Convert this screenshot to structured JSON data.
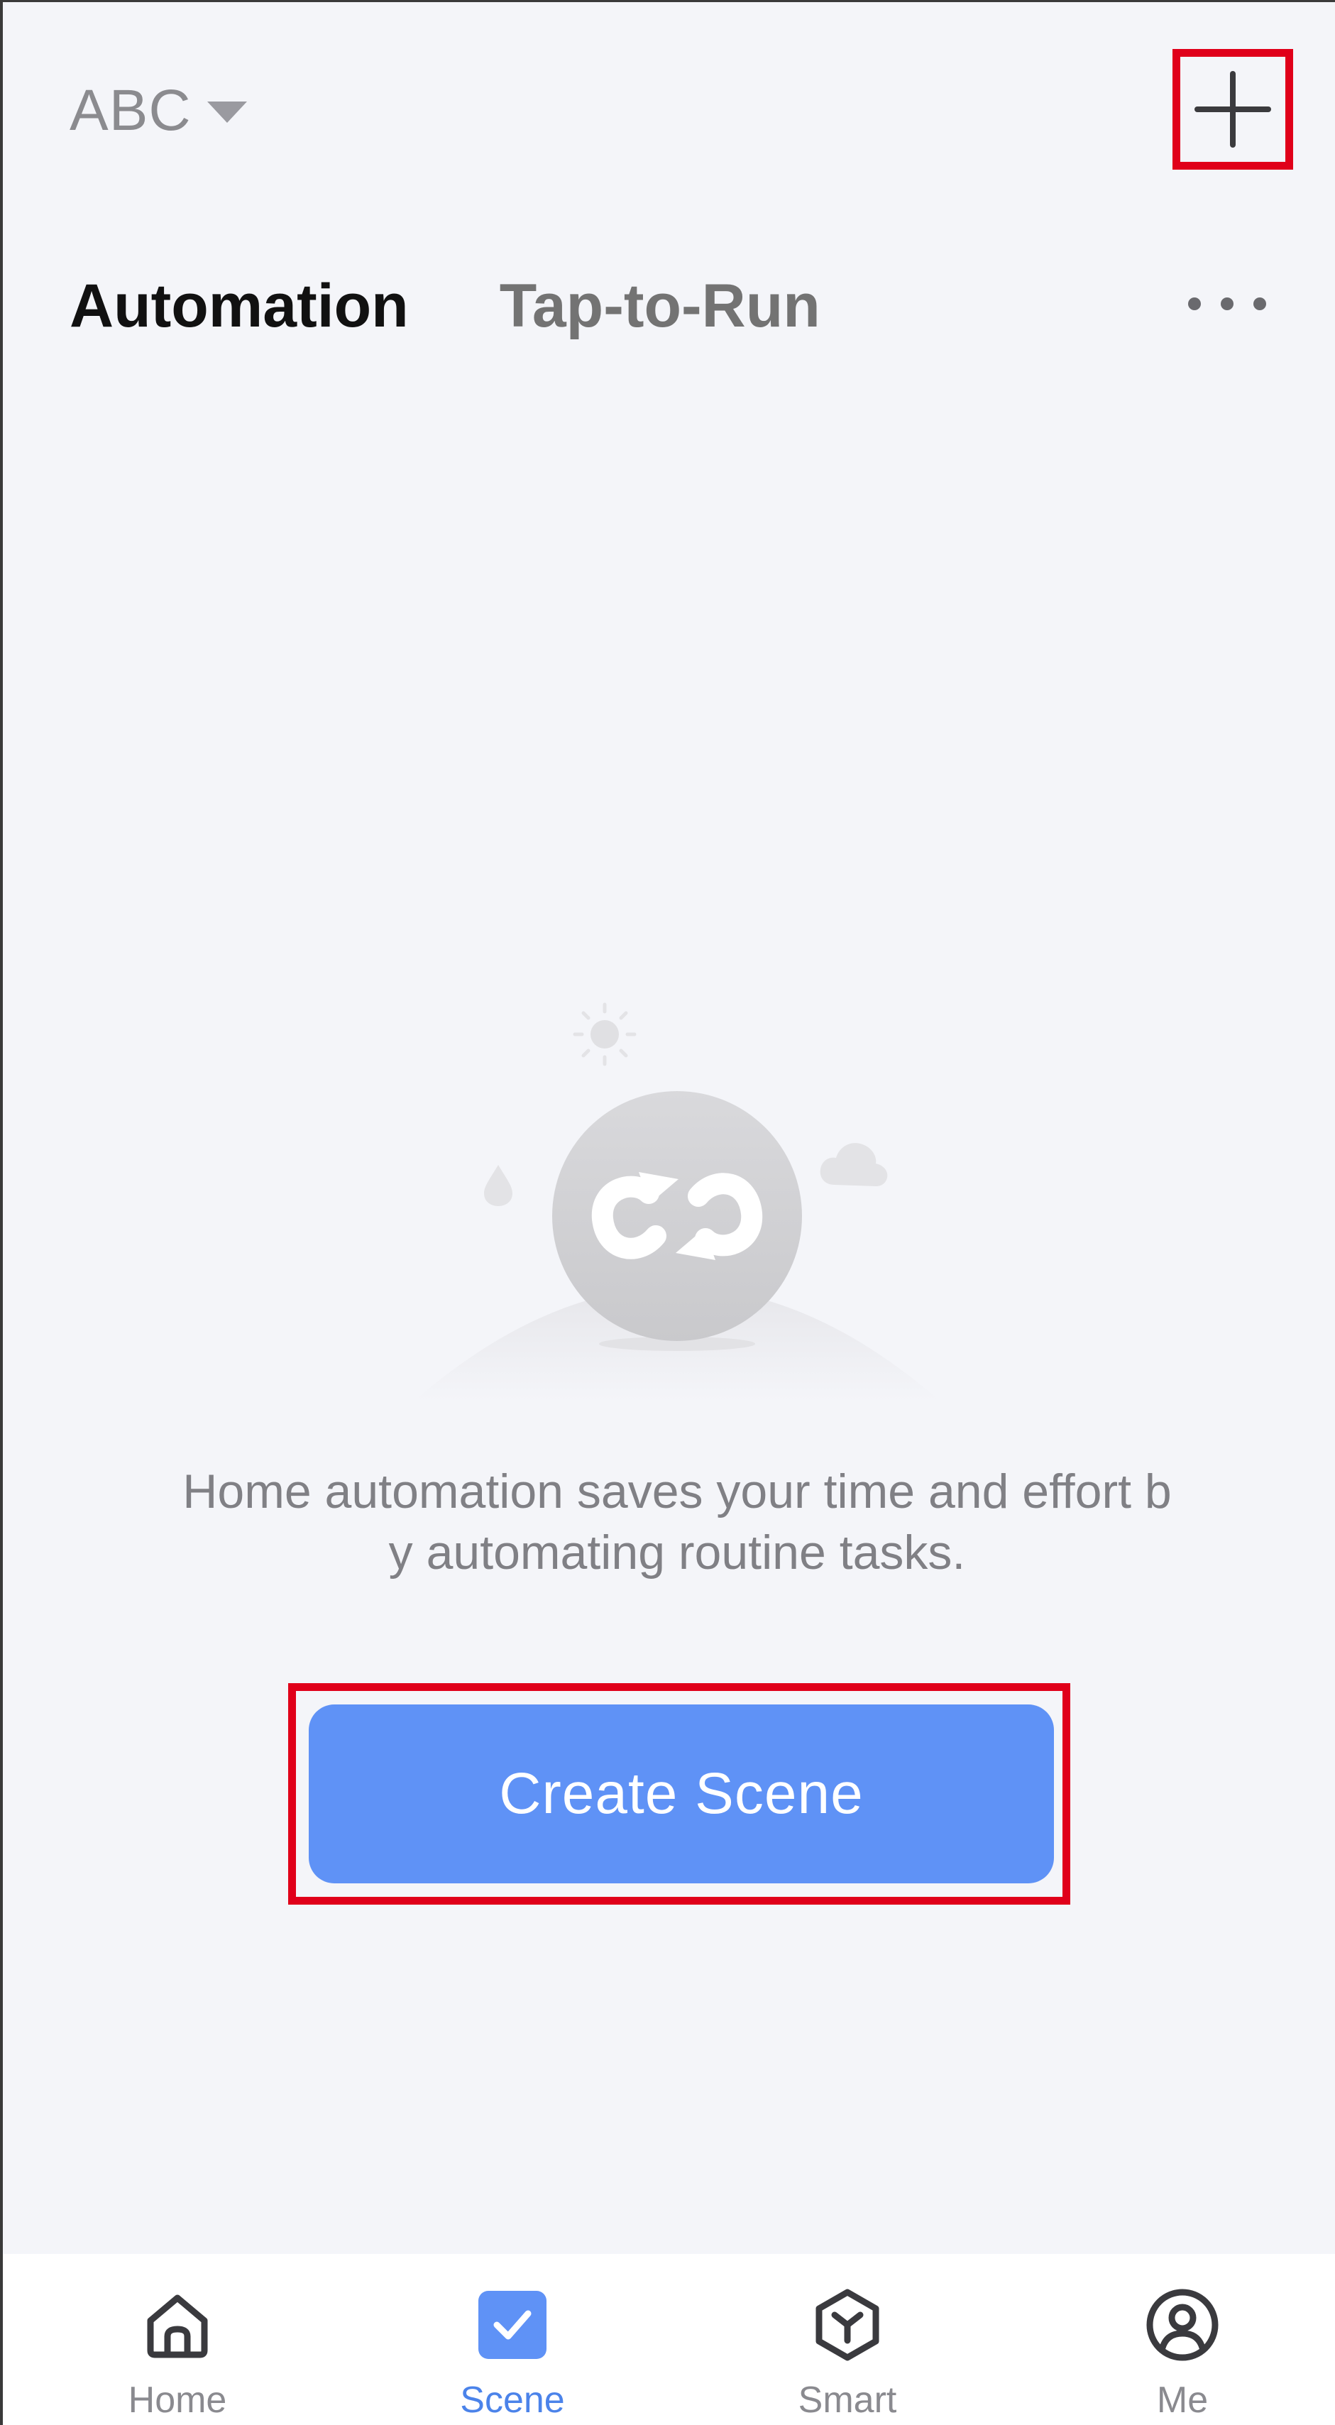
{
  "header": {
    "home_name": "ABC",
    "add_icon": "plus-icon"
  },
  "tabs": [
    {
      "label": "Automation",
      "active": true
    },
    {
      "label": "Tap-to-Run",
      "active": false
    }
  ],
  "more_icon": "more-horizontal-icon",
  "empty_state": {
    "illustration_icon": "automation-loop-icon",
    "message_line1": "Home automation saves your time and effort b",
    "message_line2": "y automating routine tasks."
  },
  "create_button_label": "Create Scene",
  "colors": {
    "accent": "#5f92f6",
    "highlight": "#e0001a",
    "active_nav": "#4b83ea"
  },
  "bottom_nav": [
    {
      "label": "Home",
      "icon": "home-icon",
      "active": false
    },
    {
      "label": "Scene",
      "icon": "scene-check-icon",
      "active": true
    },
    {
      "label": "Smart",
      "icon": "smart-cube-icon",
      "active": false
    },
    {
      "label": "Me",
      "icon": "profile-icon",
      "active": false
    }
  ]
}
